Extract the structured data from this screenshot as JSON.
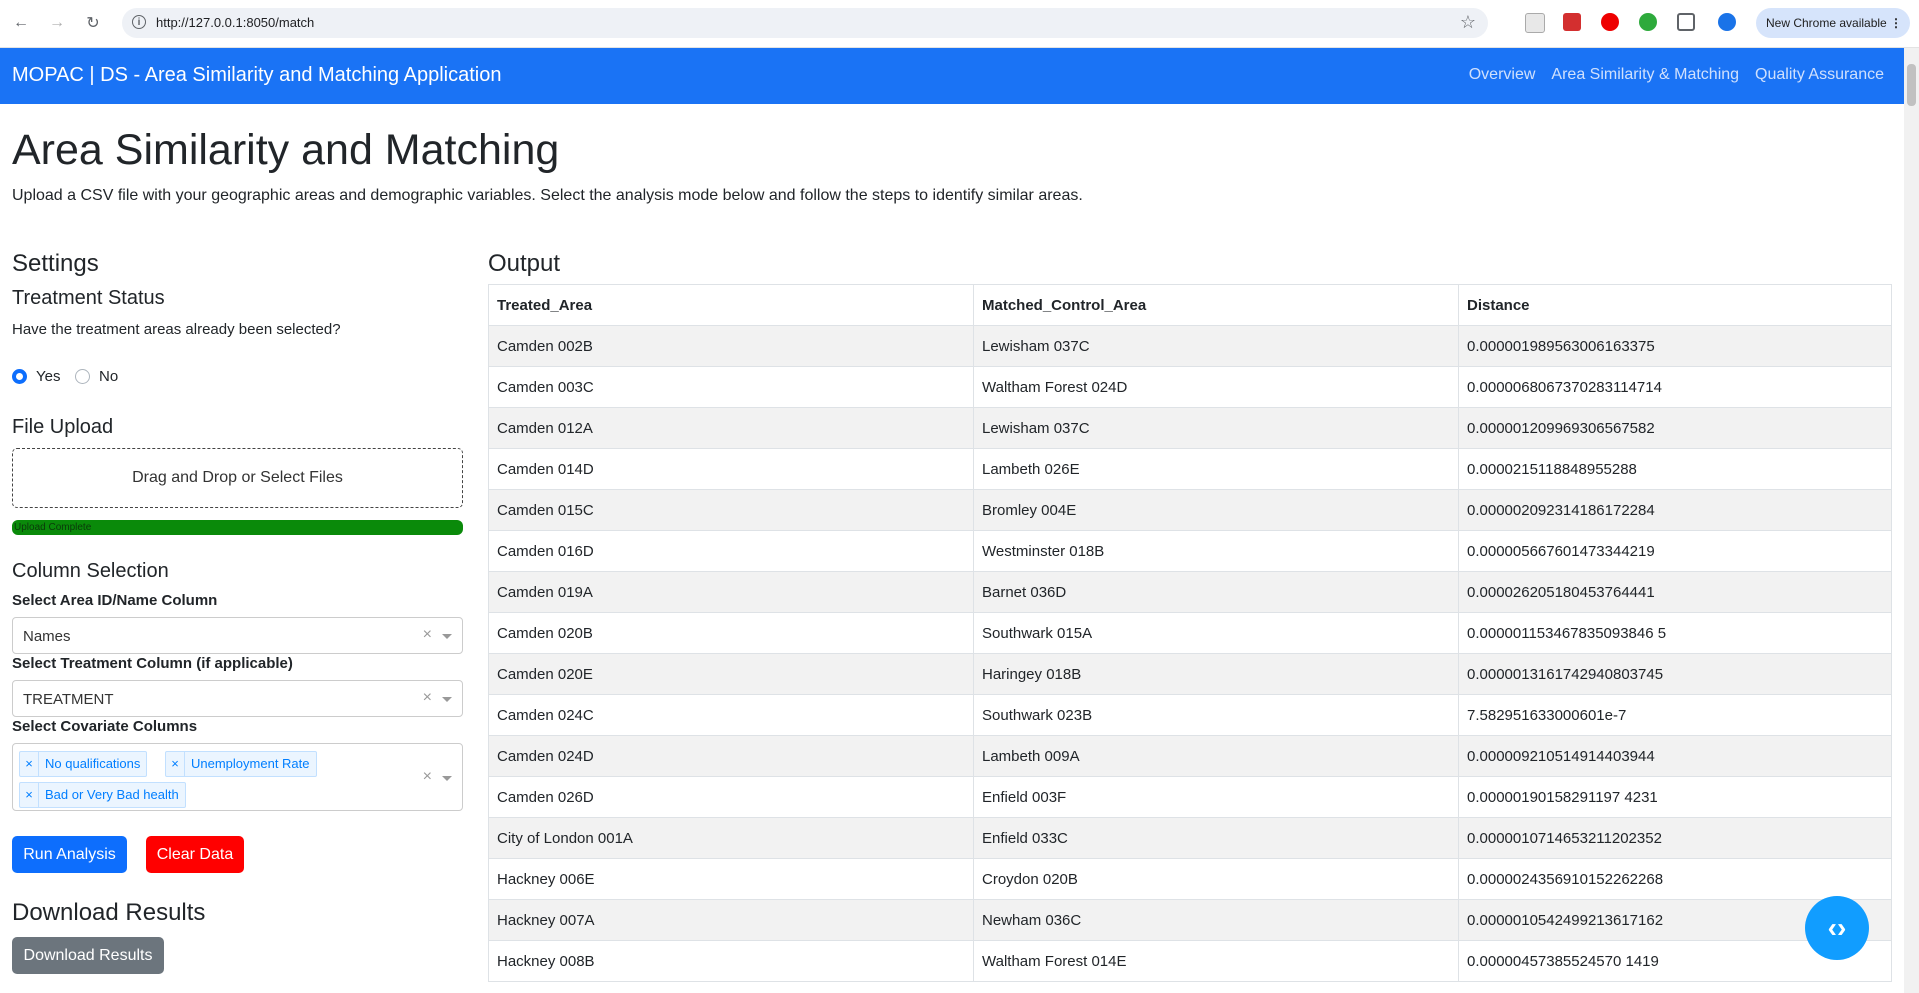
{
  "browser": {
    "url": "http://127.0.0.1:8050/match",
    "new_chrome": "New Chrome available"
  },
  "navbar": {
    "brand": "MOPAC | DS - Area Similarity and Matching Application",
    "links": [
      "Overview",
      "Area Similarity & Matching",
      "Quality Assurance"
    ]
  },
  "page": {
    "title": "Area Similarity and Matching",
    "intro": "Upload a CSV file with your geographic areas and demographic variables. Select the analysis mode below and follow the steps to identify similar areas."
  },
  "settings": {
    "heading": "Settings",
    "treatment_heading": "Treatment Status",
    "treatment_question": "Have the treatment areas already been selected?",
    "radio_yes": "Yes",
    "radio_no": "No",
    "selected": "Yes",
    "file_upload_heading": "File Upload",
    "dropzone_text": "Drag and Drop or Select Files",
    "upload_status": "Upload Complete",
    "upload_progress_pct": 100,
    "column_selection_heading": "Column Selection",
    "area_label": "Select Area ID/Name Column",
    "area_value": "Names",
    "treatment_label": "Select Treatment Column (if applicable)",
    "treatment_value": "TREATMENT",
    "covariate_label": "Select Covariate Columns",
    "covariates": [
      "No qualifications",
      "Unemployment Rate",
      "Bad or Very Bad health"
    ],
    "run_button": "Run Analysis",
    "clear_button": "Clear Data",
    "download_heading": "Download Results",
    "download_button": "Download Results",
    "colors": {
      "primary": "#0d6efd",
      "danger": "#ff0000",
      "secondary": "#6c757d",
      "progress": "#0a8a0a"
    }
  },
  "output": {
    "heading": "Output",
    "columns": [
      "Treated_Area",
      "Matched_Control_Area",
      "Distance"
    ],
    "rows": [
      [
        "Camden 002B",
        "Lewisham 037C",
        "0.000001989563006163375"
      ],
      [
        "Camden 003C",
        "Waltham Forest 024D",
        "0.0000068067370283114714"
      ],
      [
        "Camden 012A",
        "Lewisham 037C",
        "0.000001209969306567582"
      ],
      [
        "Camden 014D",
        "Lambeth 026E",
        "0.0000215118848955288"
      ],
      [
        "Camden 015C",
        "Bromley 004E",
        "0.000002092314186172284"
      ],
      [
        "Camden 016D",
        "Westminster 018B",
        "0.000005667601473344219"
      ],
      [
        "Camden 019A",
        "Barnet 036D",
        "0.000026205180453764441"
      ],
      [
        "Camden 020B",
        "Southwark 015A",
        "0.000001153467835093846 5"
      ],
      [
        "Camden 020E",
        "Haringey 018B",
        "0.0000013161742940803745"
      ],
      [
        "Camden 024C",
        "Southwark 023B",
        "7.582951633000601e-7"
      ],
      [
        "Camden 024D",
        "Lambeth 009A",
        "0.000009210514914403944"
      ],
      [
        "Camden 026D",
        "Enfield 003F",
        "0.00000190158291197 4231"
      ],
      [
        "City of London 001A",
        "Enfield 033C",
        "0.0000010714653211202352"
      ],
      [
        "Hackney 006E",
        "Croydon 020B",
        "0.0000024356910152262268"
      ],
      [
        "Hackney 007A",
        "Newham 036C",
        "0.0000010542499213617162"
      ],
      [
        "Hackney 008B",
        "Waltham Forest 014E",
        "0.00000457385524570 1419"
      ]
    ]
  }
}
